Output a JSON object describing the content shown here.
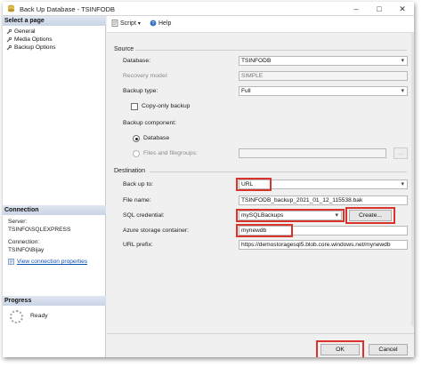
{
  "window": {
    "title": "Back Up Database - TSINFODB"
  },
  "left_pane": {
    "select_page_header": "Select a page",
    "pages": [
      {
        "label": "General",
        "icon": "wrench-icon"
      },
      {
        "label": "Media Options",
        "icon": "wrench-icon"
      },
      {
        "label": "Backup Options",
        "icon": "wrench-icon"
      }
    ],
    "connection_header": "Connection",
    "server_label": "Server:",
    "server_value": "TSINFO\\SQLEXPRESS",
    "connection_label": "Connection:",
    "connection_value": "TSINFO\\Bijay",
    "view_connection_link": "View connection properties",
    "progress_header": "Progress",
    "progress_status": "Ready"
  },
  "toolbar": {
    "script_label": "Script",
    "help_label": "Help"
  },
  "source": {
    "group_title": "Source",
    "database_label": "Database:",
    "database_value": "TSINFODB",
    "recovery_label": "Recovery model:",
    "recovery_value": "SIMPLE",
    "backup_type_label": "Backup type:",
    "backup_type_value": "Full",
    "copy_only_label": "Copy-only backup",
    "component_label": "Backup component:",
    "component_database": "Database",
    "component_files": "Files and filegroups:"
  },
  "destination": {
    "group_title": "Destination",
    "back_up_to_label": "Back up to:",
    "back_up_to_value": "URL",
    "file_name_label": "File name:",
    "file_name_value": "TSINFODB_backup_2021_01_12_115538.bak",
    "credential_label": "SQL credential:",
    "credential_value": "mySQLBackups",
    "create_button": "Create...",
    "container_label": "Azure storage container:",
    "container_value": "mynewdb",
    "url_prefix_label": "URL prefix:",
    "url_prefix_value": "https://demostoragesql5.blob.core.windows.net/mynewdb"
  },
  "footer": {
    "ok_button": "OK",
    "cancel_button": "Cancel"
  },
  "colors": {
    "highlight_box": "#d9342b",
    "link": "#0b4fb3",
    "pane_header": "#c9d4e6"
  }
}
